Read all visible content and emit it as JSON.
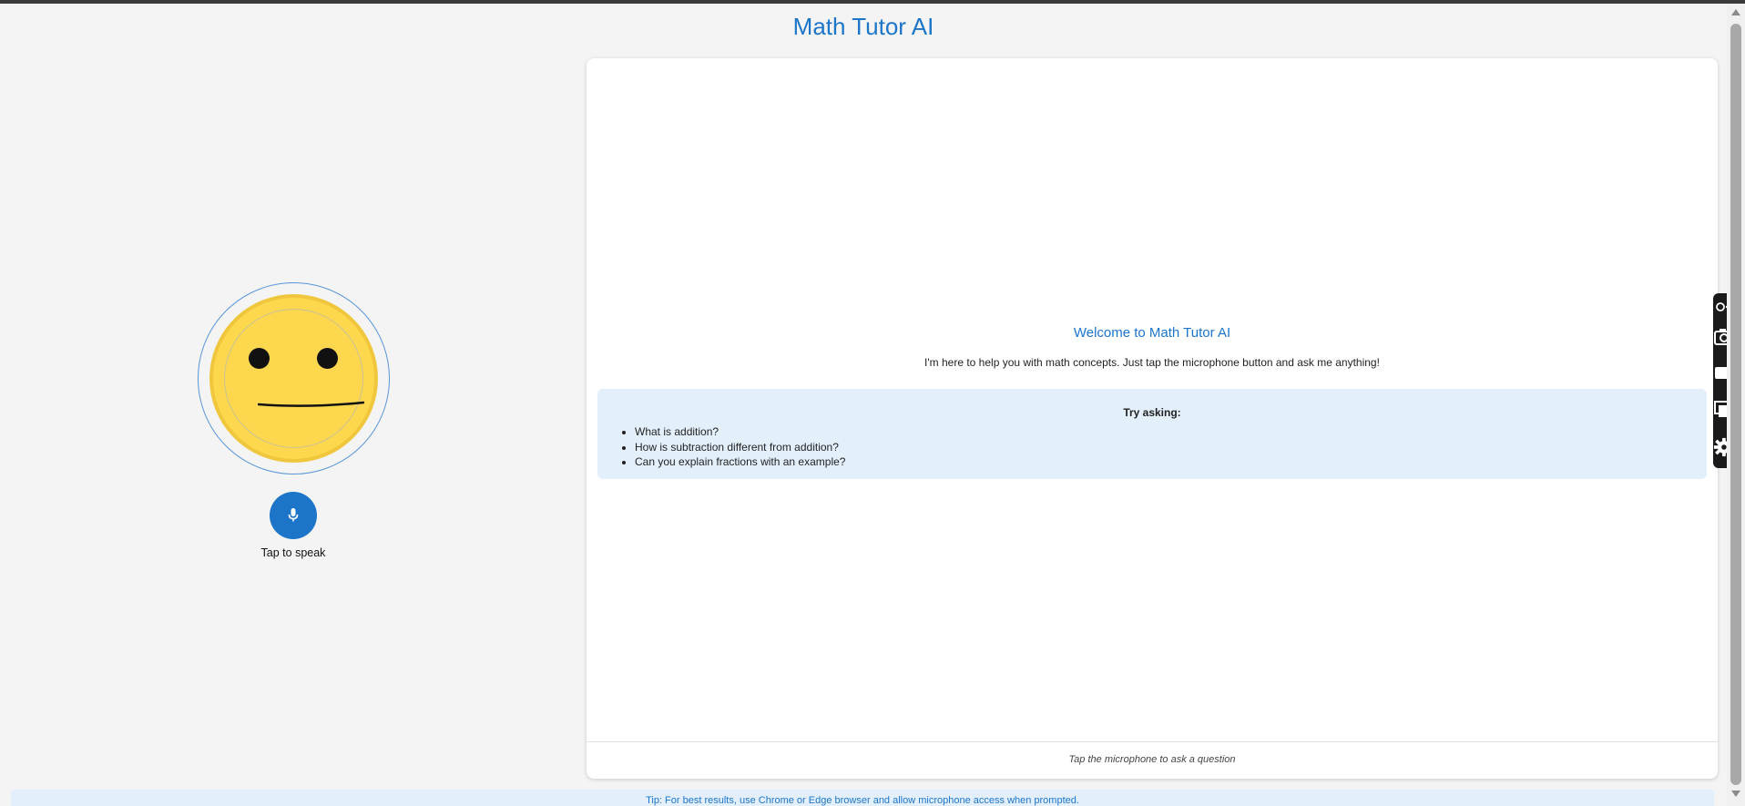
{
  "header": {
    "title": "Math Tutor AI"
  },
  "avatar": {
    "face_color": "#fdd74d",
    "ring_color": "#5a96d8"
  },
  "mic": {
    "icon": "microphone-icon",
    "label": "Tap to speak",
    "color": "#1c75c9"
  },
  "chat": {
    "welcome_title": "Welcome to Math Tutor AI",
    "welcome_text": "I'm here to help you with math concepts. Just tap the microphone button and ask me anything!",
    "suggestions": {
      "title": "Try asking:",
      "items": [
        "What is addition?",
        "How is subtraction different from addition?",
        "Can you explain fractions with an example?"
      ]
    },
    "footer_text": "Tap the microphone to ask a question"
  },
  "tip": {
    "text": "Tip: For best results, use Chrome or Edge browser and allow microphone access when prompted."
  },
  "side_toolbar": {
    "tools": [
      "extension-icon",
      "camera-icon",
      "video-icon",
      "windows-icon",
      "gear-icon"
    ]
  },
  "colors": {
    "accent": "#1c75c9",
    "background": "#f4f4f4",
    "suggestions_bg": "#e3f0fb"
  }
}
